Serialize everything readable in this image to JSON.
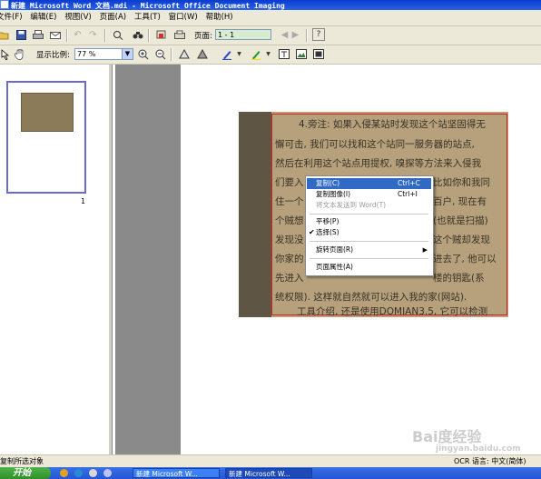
{
  "window": {
    "title": "新建 Microsoft Word 文档.mdi - Microsoft Office Document Imaging"
  },
  "menu": {
    "items": [
      "文件(F)",
      "编辑(E)",
      "视图(V)",
      "页面(A)",
      "工具(T)",
      "窗口(W)",
      "帮助(H)"
    ]
  },
  "toolbar": {
    "page_label": "页面:",
    "page_value": "1 - 1",
    "zoom_label": "显示比例:",
    "zoom_value": "77 %",
    "help_glyph": "?"
  },
  "thumbnails": [
    {
      "page_number": "1"
    }
  ],
  "document": {
    "lines": [
      "4.旁注: 如果入侵某站时发现这个站坚固得无",
      "懈可击, 我们可以找和这个站同一服务器的站点,",
      "然后在利用这个站点用提权, 嗅探等方法来入侵我",
      "们要入",
      "住一个",
      "个贼想",
      "发现没",
      "你家的",
      "先进入",
      "统权限). 这样就自然就可以进入我的家(网站).",
      "工具介绍, 还是使用DOMIAN3.5, 它可以检测"
    ],
    "right_fragments": [
      "比如你和我同",
      "百户, 现在有",
      "(也就是扫描)",
      "这个贼却发现",
      "进去了, 他可以",
      "楼的钥匙(系"
    ]
  },
  "context_menu": {
    "items": [
      {
        "label": "复制(C)",
        "shortcut": "Ctrl+C",
        "highlighted": true
      },
      {
        "label": "复制图像(I)",
        "shortcut": "Ctrl+I"
      },
      {
        "label": "将文本发送到 Word(T)",
        "disabled": true
      },
      {
        "label": "平移(P)"
      },
      {
        "label": "选择(S)",
        "checked": true
      },
      {
        "label": "旋转页面(R)",
        "submenu": true
      },
      {
        "label": "页面属性(A)"
      }
    ]
  },
  "status": {
    "left": "复制所选对象",
    "right": "OCR 语言: 中文(简体)"
  },
  "taskbar": {
    "start_label": "开始",
    "tasks": [
      "新建 Microsoft W...",
      "新建 Microsoft W..."
    ]
  },
  "watermark": {
    "text": "Bai度经验",
    "sub": "jingyan.baidu.com"
  },
  "colors": {
    "title_bar": "#0a3bd1",
    "highlight": "#316ac5",
    "selection_frame": "#d42020",
    "scan_paper": "#b6a17c"
  }
}
